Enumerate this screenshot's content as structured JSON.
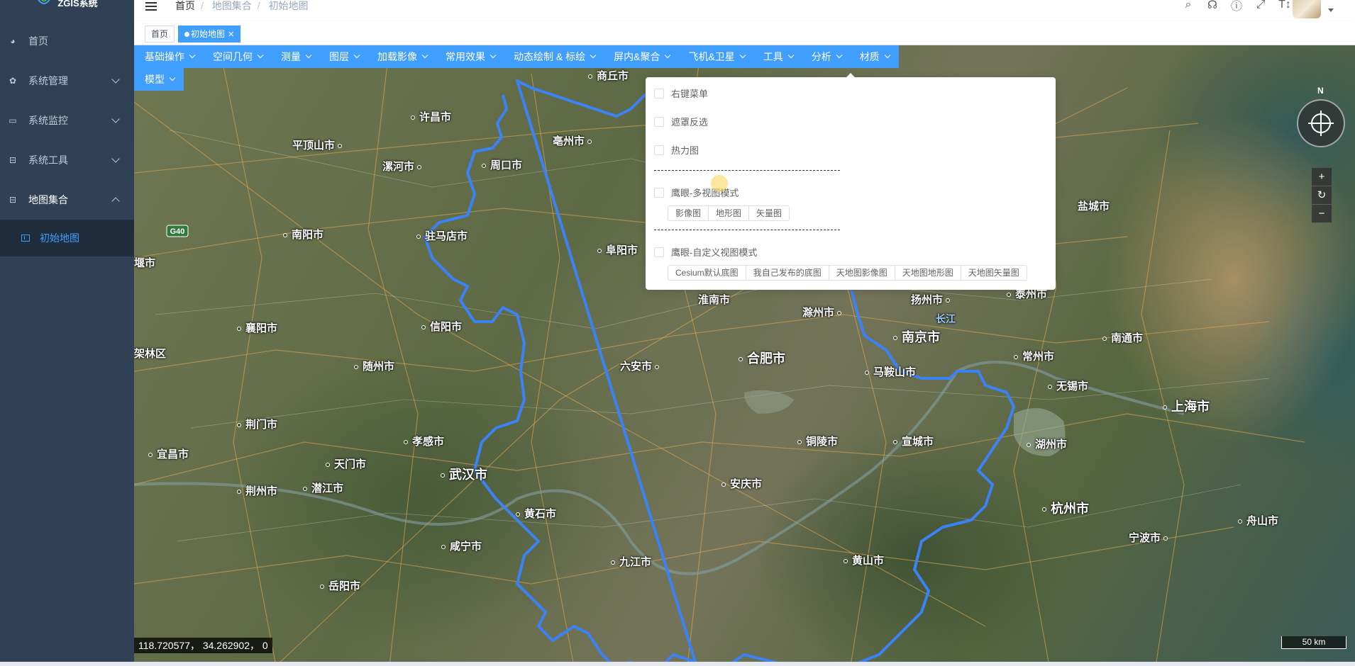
{
  "app": {
    "title": "ZGIS系统"
  },
  "sidebar": {
    "items": [
      {
        "label": "首页",
        "icon": "dashboard-icon"
      },
      {
        "label": "系统管理",
        "icon": "gear-icon"
      },
      {
        "label": "系统监控",
        "icon": "monitor-icon"
      },
      {
        "label": "系统工具",
        "icon": "toolbox-icon"
      },
      {
        "label": "地图集合",
        "icon": "toolbox-icon"
      }
    ],
    "sub_items": [
      {
        "label": "初始地图",
        "icon": "map-icon"
      }
    ]
  },
  "header": {
    "breadcrumb": [
      "首页",
      "地图集合",
      "初始地图"
    ],
    "icons": [
      "search-icon",
      "github-icon",
      "help-icon",
      "fullscreen-icon",
      "font-size-icon"
    ]
  },
  "tags": {
    "home": "首页",
    "current": "初始地图"
  },
  "toolbar": {
    "row1": [
      "基础操作",
      "空间几何",
      "测量",
      "图层",
      "加载影像",
      "常用效果",
      "动态绘制 & 标绘",
      "屏内&聚合",
      "飞机&卫星",
      "工具",
      "分析",
      "材质"
    ],
    "row2": [
      "模型"
    ]
  },
  "tools_panel": {
    "checkboxes": [
      "右键菜单",
      "遮罩反选",
      "热力图",
      "鹰眼-多视图模式",
      "鹰眼-自定义视图模式"
    ],
    "multi_view_buttons": [
      "影像图",
      "地形图",
      "矢量图"
    ],
    "custom_view_buttons": [
      "Cesium默认底图",
      "我自己发布的底图",
      "天地图影像图",
      "天地图地形图",
      "天地图矢量图"
    ]
  },
  "map": {
    "cities": [
      {
        "name": "商丘市"
      },
      {
        "name": "许昌市"
      },
      {
        "name": "亳州市"
      },
      {
        "name": "平顶山市"
      },
      {
        "name": "漯河市"
      },
      {
        "name": "周口市"
      },
      {
        "name": "南阳市"
      },
      {
        "name": "驻马店市"
      },
      {
        "name": "阜阳市"
      },
      {
        "name": "堰市"
      },
      {
        "name": "淮南市"
      },
      {
        "name": "扬州市"
      },
      {
        "name": "泰州市"
      },
      {
        "name": "襄阳市"
      },
      {
        "name": "信阳市"
      },
      {
        "name": "滁州市"
      },
      {
        "name": "南京市"
      },
      {
        "name": "南通市"
      },
      {
        "name": "架林区"
      },
      {
        "name": "随州市"
      },
      {
        "name": "六安市"
      },
      {
        "name": "合肥市"
      },
      {
        "name": "马鞍山市"
      },
      {
        "name": "常州市"
      },
      {
        "name": "无锡市"
      },
      {
        "name": "上海市"
      },
      {
        "name": "荆门市"
      },
      {
        "name": "孝感市"
      },
      {
        "name": "铜陵市"
      },
      {
        "name": "宣城市"
      },
      {
        "name": "湖州市"
      },
      {
        "name": "宜昌市"
      },
      {
        "name": "天门市"
      },
      {
        "name": "武汉市"
      },
      {
        "name": "荆州市"
      },
      {
        "name": "潜江市"
      },
      {
        "name": "安庆市"
      },
      {
        "name": "杭州市"
      },
      {
        "name": "黄石市"
      },
      {
        "name": "舟山市"
      },
      {
        "name": "咸宁市"
      },
      {
        "name": "宁波市"
      },
      {
        "name": "九江市"
      },
      {
        "name": "黄山市"
      },
      {
        "name": "岳阳市"
      },
      {
        "name": "盐城市"
      }
    ],
    "road_label": "G40",
    "river_label": "长江",
    "border_color": "#3b82f6"
  },
  "coordinates": "118.720577， 34.262902， 0",
  "scale": "50 km",
  "compass_north": "N",
  "zoom": {
    "in": "+",
    "reset": "↻",
    "out": "−"
  },
  "colors": {
    "accent": "#409eff",
    "sidebar_bg": "#304156"
  }
}
